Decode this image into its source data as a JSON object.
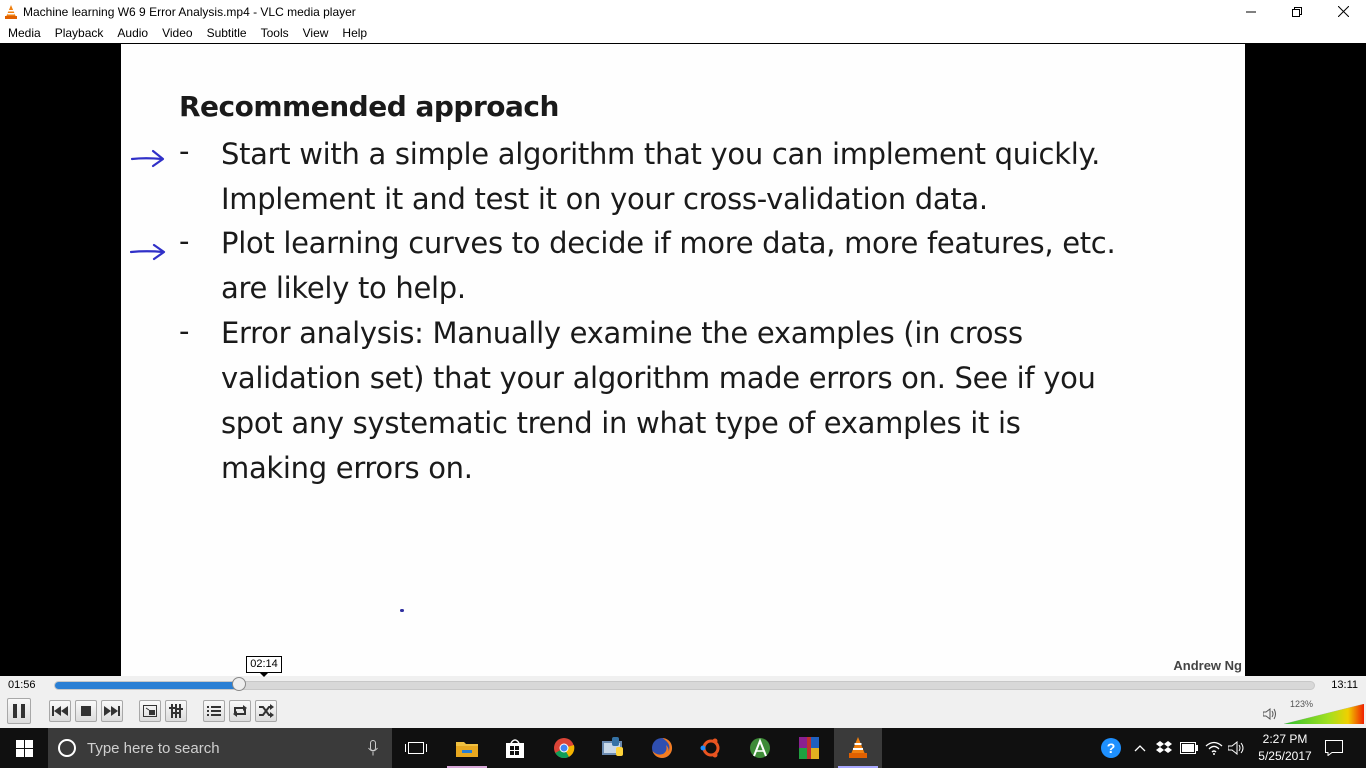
{
  "window": {
    "title": "Machine learning W6 9 Error Analysis.mp4 - VLC media player"
  },
  "menu": [
    "Media",
    "Playback",
    "Audio",
    "Video",
    "Subtitle",
    "Tools",
    "View",
    "Help"
  ],
  "slide": {
    "title": "Recommended approach",
    "bullet_marker": "-",
    "bullets": [
      {
        "lines": [
          "Start with a simple algorithm that you can implement quickly.",
          "Implement it and test it on your cross-validation data."
        ],
        "pen_arrow": true
      },
      {
        "lines": [
          "Plot learning curves to decide if more data, more features, etc.",
          "are likely to help."
        ],
        "pen_arrow": true
      },
      {
        "lines": [
          "Error analysis:  Manually examine the examples (in cross",
          "validation set) that your algorithm made errors on. See if you",
          "spot any systematic trend in what type of examples it is",
          "making errors on."
        ],
        "pen_arrow": false
      }
    ],
    "credit": "Andrew Ng"
  },
  "player": {
    "time_current": "01:56",
    "time_total": "13:11",
    "hover_time": "02:14",
    "progress_fraction": 0.147,
    "volume_label": "123%",
    "volume_fraction": 1.0
  },
  "controls": {
    "icons": [
      "pause-icon",
      "previous-icon",
      "stop-icon",
      "next-icon",
      "fullscreen-icon",
      "extended-settings-icon",
      "playlist-icon",
      "loop-icon",
      "shuffle-icon"
    ]
  },
  "taskbar": {
    "search_placeholder": "Type here to search",
    "apps": [
      "task-view-icon",
      "file-explorer-icon",
      "store-icon",
      "chrome-icon",
      "python-idle-icon",
      "firefox-icon",
      "ubuntu-icon",
      "android-studio-icon",
      "winrar-icon",
      "vlc-icon"
    ],
    "time": "2:27 PM",
    "date": "5/25/2017"
  },
  "colors": {
    "accent": "#2a7fd4",
    "pen": "#3030c8",
    "taskbar": "#101010"
  }
}
